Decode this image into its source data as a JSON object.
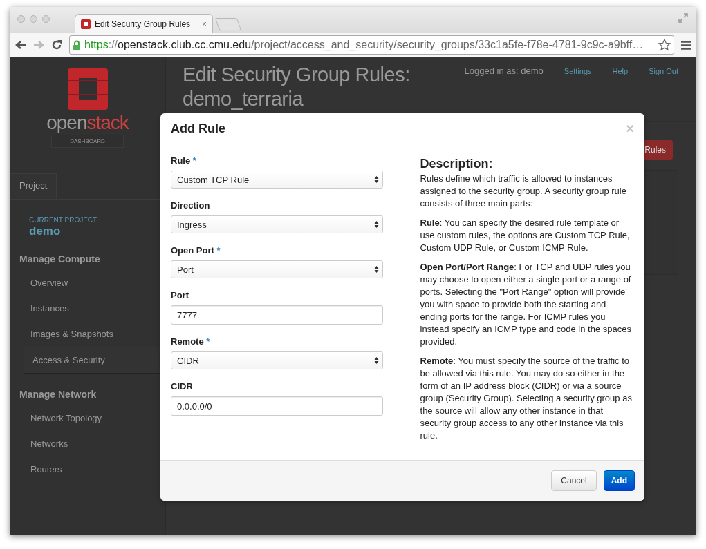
{
  "browser": {
    "tab_title": "Edit Security Group Rules",
    "tab_close": "×",
    "url": {
      "scheme": "https",
      "separator": "://",
      "host": "openstack.club.cc.cmu.edu",
      "path": "/project/access_and_security/security_groups/33c1a5fe-f78e-4781-9c9c-a9bff…"
    }
  },
  "sidebar": {
    "logo": {
      "word_a": "open",
      "word_b": "stack",
      "tagline": "DASHBOARD"
    },
    "tab": "Project",
    "project_label": "CURRENT PROJECT",
    "project": "demo",
    "groups": [
      {
        "heading": "Manage Compute",
        "items": [
          {
            "label": "Overview",
            "selected": false
          },
          {
            "label": "Instances",
            "selected": false
          },
          {
            "label": "Images & Snapshots",
            "selected": false
          },
          {
            "label": "Access & Security",
            "selected": true
          }
        ]
      },
      {
        "heading": "Manage Network",
        "items": [
          {
            "label": "Network Topology",
            "selected": false
          },
          {
            "label": "Networks",
            "selected": false
          },
          {
            "label": "Routers",
            "selected": false
          }
        ]
      }
    ]
  },
  "header": {
    "title": "Edit Security Group Rules: demo_terraria",
    "logged_in": "Logged in as: demo",
    "links": [
      "Settings",
      "Help",
      "Sign Out"
    ],
    "action_button": "Rules"
  },
  "modal": {
    "title": "Add Rule",
    "close": "×",
    "fields": [
      {
        "kind": "select",
        "label": "Rule",
        "marker": "*",
        "value": "Custom TCP Rule"
      },
      {
        "kind": "select",
        "label": "Direction",
        "value": "Ingress"
      },
      {
        "kind": "select",
        "label": "Open Port",
        "marker": "*",
        "value": "Port"
      },
      {
        "kind": "input",
        "label": "Port",
        "value": "7777"
      },
      {
        "kind": "select",
        "label": "Remote",
        "marker": "*",
        "value": "CIDR"
      },
      {
        "kind": "input",
        "label": "CIDR",
        "value": "0.0.0.0/0"
      }
    ],
    "description": {
      "title": "Description:",
      "paragraphs": [
        "Rules define which traffic is allowed to instances assigned to the security group. A security group rule consists of three main parts:",
        "**Rule**: You can specify the desired rule template or use custom rules, the options are Custom TCP Rule, Custom UDP Rule, or Custom ICMP Rule.",
        "**Open Port/Port Range**: For TCP and UDP rules you may choose to open either a single port or a range of ports. Selecting the \"Port Range\" option will provide you with space to provide both the starting and ending ports for the range. For ICMP rules you instead specify an ICMP type and code in the spaces provided.",
        "**Remote**: You must specify the source of the traffic to be allowed via this rule. You may do so either in the form of an IP address block (CIDR) or via a source group (Security Group). Selecting a security group as the source will allow any other instance in that security group access to any other instance via this rule."
      ]
    },
    "buttons": [
      {
        "kind": "secondary",
        "label": "Cancel"
      },
      {
        "kind": "primary",
        "label": "Add"
      }
    ]
  }
}
